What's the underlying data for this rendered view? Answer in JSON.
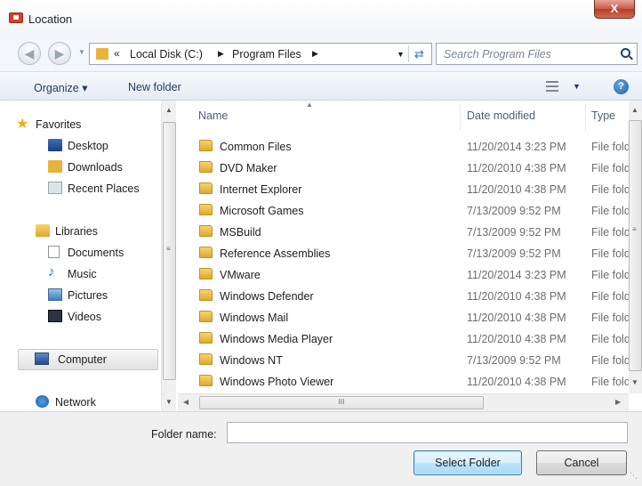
{
  "window": {
    "title": "Location",
    "close_glyph": "X"
  },
  "navbar": {
    "breadcrumb_prefix": "«",
    "crumbs": [
      "Local Disk (C:)",
      "Program Files"
    ],
    "search_placeholder": "Search Program Files"
  },
  "toolbar": {
    "organize_label": "Organize ▾",
    "new_folder_label": "New folder"
  },
  "navpane": {
    "favorites": "Favorites",
    "desktop": "Desktop",
    "downloads": "Downloads",
    "recent": "Recent Places",
    "libraries": "Libraries",
    "documents": "Documents",
    "music": "Music",
    "pictures": "Pictures",
    "videos": "Videos",
    "computer": "Computer",
    "network": "Network"
  },
  "columns": {
    "name": "Name",
    "date": "Date modified",
    "type": "Type"
  },
  "files": [
    {
      "name": "Common Files",
      "date": "11/20/2014 3:23 PM",
      "type": "File folder"
    },
    {
      "name": "DVD Maker",
      "date": "11/20/2010 4:38 PM",
      "type": "File folder"
    },
    {
      "name": "Internet Explorer",
      "date": "11/20/2010 4:38 PM",
      "type": "File folder"
    },
    {
      "name": "Microsoft Games",
      "date": "7/13/2009 9:52 PM",
      "type": "File folder"
    },
    {
      "name": "MSBuild",
      "date": "7/13/2009 9:52 PM",
      "type": "File folder"
    },
    {
      "name": "Reference Assemblies",
      "date": "7/13/2009 9:52 PM",
      "type": "File folder"
    },
    {
      "name": "VMware",
      "date": "11/20/2014 3:23 PM",
      "type": "File folder"
    },
    {
      "name": "Windows Defender",
      "date": "11/20/2010 4:38 PM",
      "type": "File folder"
    },
    {
      "name": "Windows Mail",
      "date": "11/20/2010 4:38 PM",
      "type": "File folder"
    },
    {
      "name": "Windows Media Player",
      "date": "11/20/2010 4:38 PM",
      "type": "File folder"
    },
    {
      "name": "Windows NT",
      "date": "7/13/2009 9:52 PM",
      "type": "File folder"
    },
    {
      "name": "Windows Photo Viewer",
      "date": "11/20/2010 4:38 PM",
      "type": "File folder"
    }
  ],
  "bottom": {
    "folder_name_label": "Folder name:",
    "folder_name_value": "",
    "select_label": "Select Folder",
    "cancel_label": "Cancel"
  },
  "colors": {
    "accent": "#3c7fb1",
    "folder": "#e8b33c",
    "close": "#c75a46"
  },
  "icons": [
    "app-icon",
    "close-icon",
    "back-icon",
    "forward-icon",
    "refresh-icon",
    "search-icon",
    "view-icon",
    "help-icon",
    "folder-icon",
    "star-icon",
    "desktop-icon",
    "downloads-icon",
    "recent-places-icon",
    "libraries-icon",
    "documents-icon",
    "music-icon",
    "pictures-icon",
    "videos-icon",
    "computer-icon",
    "network-icon"
  ]
}
